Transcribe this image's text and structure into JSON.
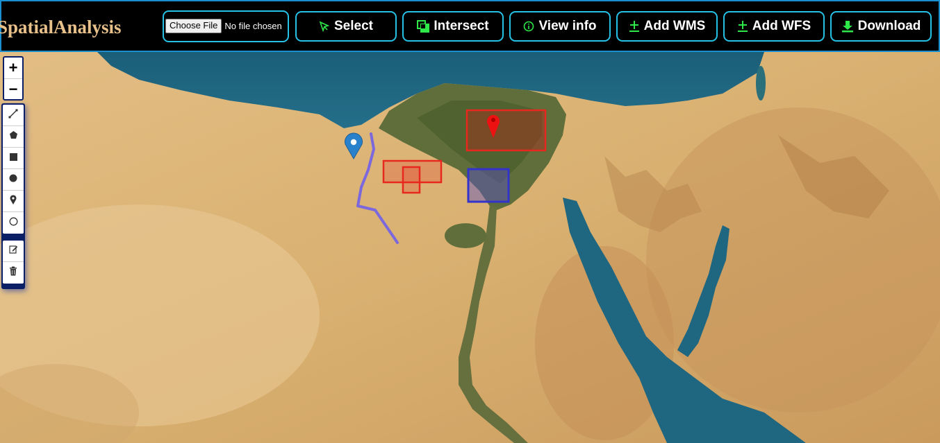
{
  "header": {
    "brand": "SpatialAnalysis",
    "file_button": "Choose File",
    "file_status": "No file chosen",
    "buttons": [
      {
        "label": "Select",
        "icon": "cursor-icon"
      },
      {
        "label": "Intersect",
        "icon": "intersect-icon"
      },
      {
        "label": "View info",
        "icon": "info-icon"
      },
      {
        "label": "Add WMS",
        "icon": "plus-icon"
      },
      {
        "label": "Add WFS",
        "icon": "plus-icon"
      },
      {
        "label": "Download",
        "icon": "download-icon"
      }
    ],
    "accent_color": "#25c2e6",
    "icon_color": "#2ee84a"
  },
  "map": {
    "zoom_in": "+",
    "zoom_out": "−",
    "draw_tools": [
      "polyline-icon",
      "polygon-icon",
      "rectangle-icon",
      "circle-icon",
      "marker-icon",
      "circle-marker-icon"
    ],
    "edit_tools": [
      "edit-icon",
      "delete-icon"
    ],
    "layer_colors": {
      "red": "#e8281e",
      "blue": "#3333cc",
      "line": "#7b68dd",
      "marker_blue": "#2a81cb"
    }
  }
}
